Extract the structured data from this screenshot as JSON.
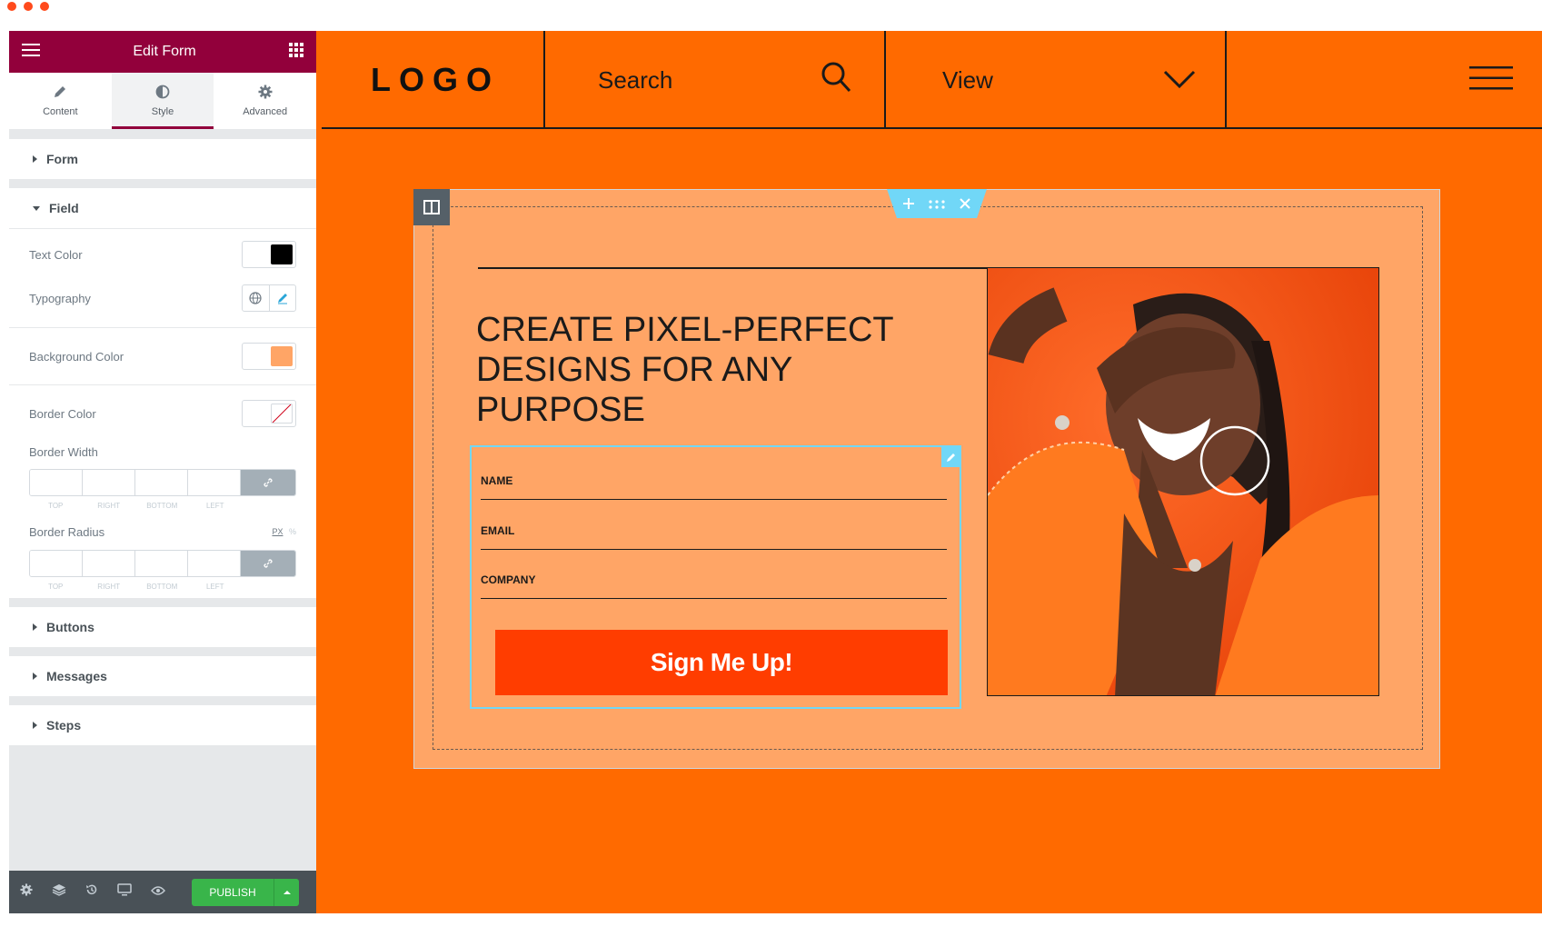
{
  "window": {
    "title": "Edit Form"
  },
  "panel": {
    "tabs": [
      {
        "label": "Content",
        "icon": "pencil-icon"
      },
      {
        "label": "Style",
        "icon": "contrast-icon"
      },
      {
        "label": "Advanced",
        "icon": "gear-icon"
      }
    ],
    "sections": {
      "form": "Form",
      "field": "Field",
      "buttons": "Buttons",
      "messages": "Messages",
      "steps": "Steps"
    },
    "controls": {
      "text_color": "Text Color",
      "typography": "Typography",
      "background_color": "Background Color",
      "border_color": "Border Color",
      "border_width": "Border Width",
      "border_radius": "Border Radius",
      "unit_px": "PX",
      "unit_pct": "%"
    },
    "dimension_labels": [
      "TOP",
      "RIGHT",
      "BOTTOM",
      "LEFT"
    ],
    "publish": "PUBLISH",
    "colors": {
      "text": "#000000",
      "background": "#ffa566"
    }
  },
  "site": {
    "logo": "LOGO",
    "search": "Search",
    "view": "View",
    "headline": "CREATE PIXEL-PERFECT DESIGNS FOR ANY PURPOSE",
    "form": {
      "fields": [
        "NAME",
        "EMAIL",
        "COMPANY"
      ],
      "submit": "Sign Me Up!"
    }
  }
}
